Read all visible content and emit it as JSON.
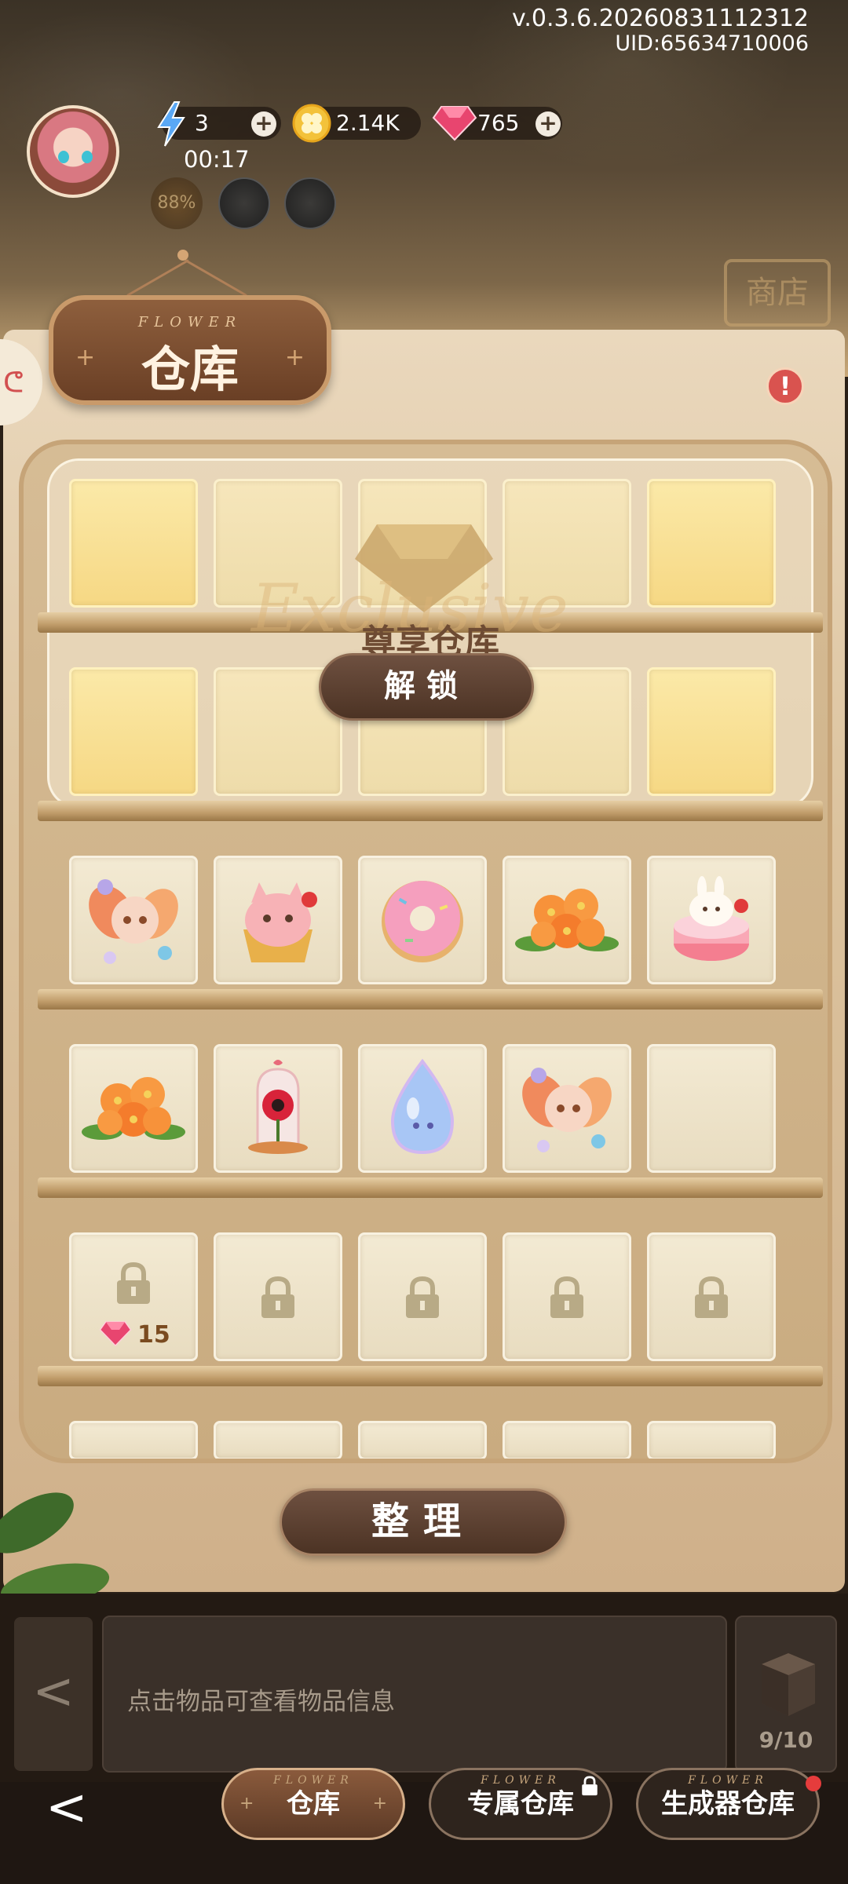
{
  "header": {
    "version": "v.0.3.6.20260831112312",
    "uid": "UID:65634710006",
    "energy": "3",
    "coins": "2.14K",
    "gems": "765",
    "timer": "00:17",
    "buff_percent": "88%"
  },
  "panel": {
    "title": "仓库",
    "title_sub": "FLOWER",
    "alert": "!"
  },
  "exclusive": {
    "title": "尊享仓库",
    "script": "Exclusive",
    "unlock_label": "解锁"
  },
  "grid": {
    "row1": [
      "fox-flower-item",
      "cat-tart-item",
      "donut-item",
      "orange-flower-item",
      "bunny-cake-item"
    ],
    "row2": [
      "orange-flower-item",
      "rose-jar-item",
      "water-drop-item",
      "fox-flower-item",
      "empty"
    ],
    "locked_cost": "15"
  },
  "actions": {
    "sort_label": "整理",
    "info_text": "点击物品可查看物品信息",
    "box_count": "9/10"
  },
  "tabs": [
    {
      "label": "仓库",
      "sub": "FLOWER",
      "active": true
    },
    {
      "label": "专属仓库",
      "sub": "FLOWER",
      "locked": true
    },
    {
      "label": "生成器仓库",
      "sub": "FLOWER",
      "badge": true
    }
  ],
  "colors": {
    "accent_brown": "#5c3a26",
    "gold_slot": "#f6d884",
    "gem_pink": "#e8456f",
    "alert_red": "#d9534f"
  }
}
